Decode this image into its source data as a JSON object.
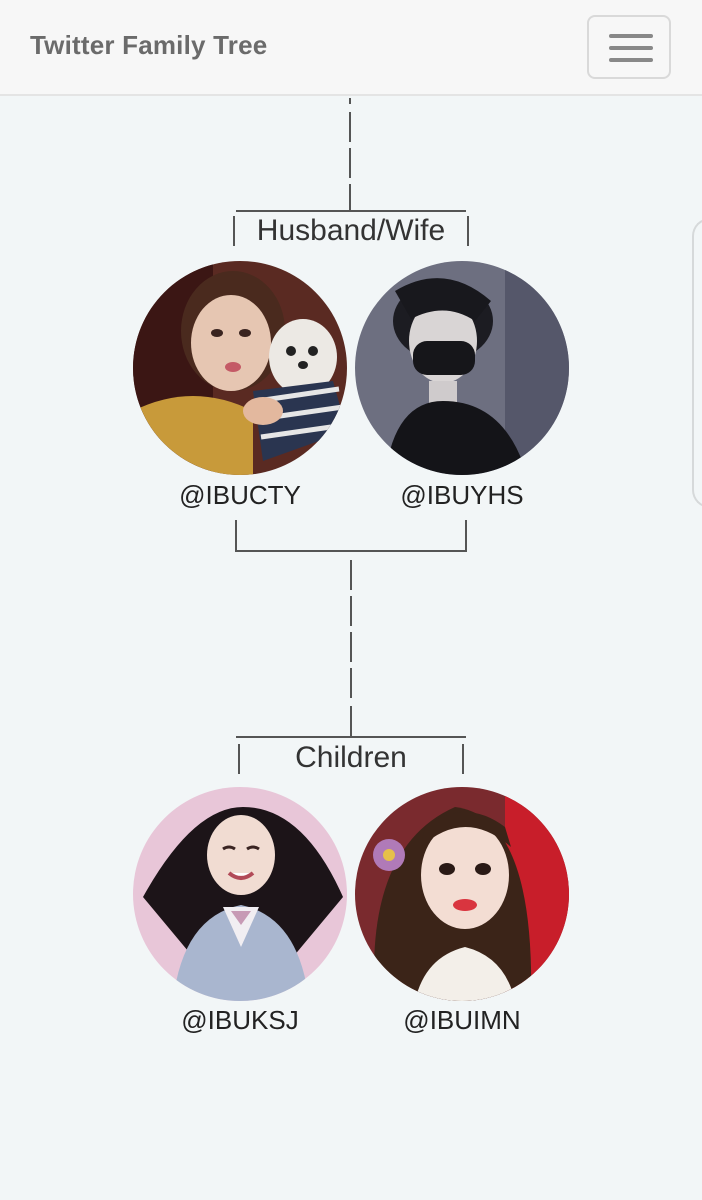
{
  "navbar": {
    "brand": "Twitter Family Tree",
    "menu_icon": "hamburger-menu-icon"
  },
  "tree": {
    "parents_label": "Husband/Wife",
    "children_label": "Children",
    "parents": [
      {
        "handle": "@IBUCTY"
      },
      {
        "handle": "@IBUYHS"
      }
    ],
    "children": [
      {
        "handle": "@IBUKSJ"
      },
      {
        "handle": "@IBUIMN"
      }
    ]
  }
}
